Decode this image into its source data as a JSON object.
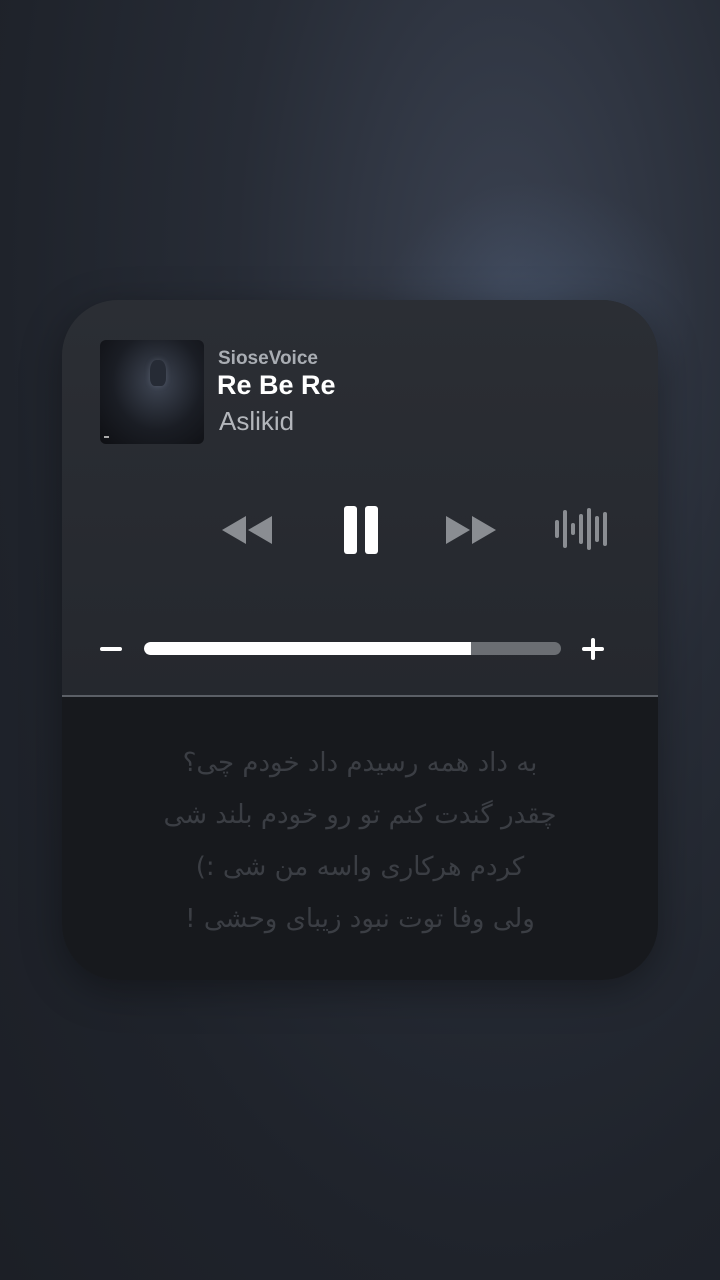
{
  "player": {
    "source": "SioseVoice",
    "title": "Re Be Re",
    "artist": "Aslikid"
  },
  "controls": {
    "rewind_icon": "rewind-icon",
    "pause_icon": "pause-icon",
    "forward_icon": "fast-forward-icon",
    "voice_icon": "waveform-icon"
  },
  "volume": {
    "minus": "−",
    "plus": "+",
    "level": 0.785
  },
  "lyrics": [
    "به داد همه رسیدم داد خودم چی؟",
    "چقدر گندت کنم تو رو خودم بلند شی",
    "کردم هرکاری واسه من شی :)",
    "ولی وفا توت نبود زیبای وحشی !"
  ],
  "colors": {
    "accent": "#ffffff",
    "track": "#6b6e73",
    "lyric": "#3b3e44"
  }
}
